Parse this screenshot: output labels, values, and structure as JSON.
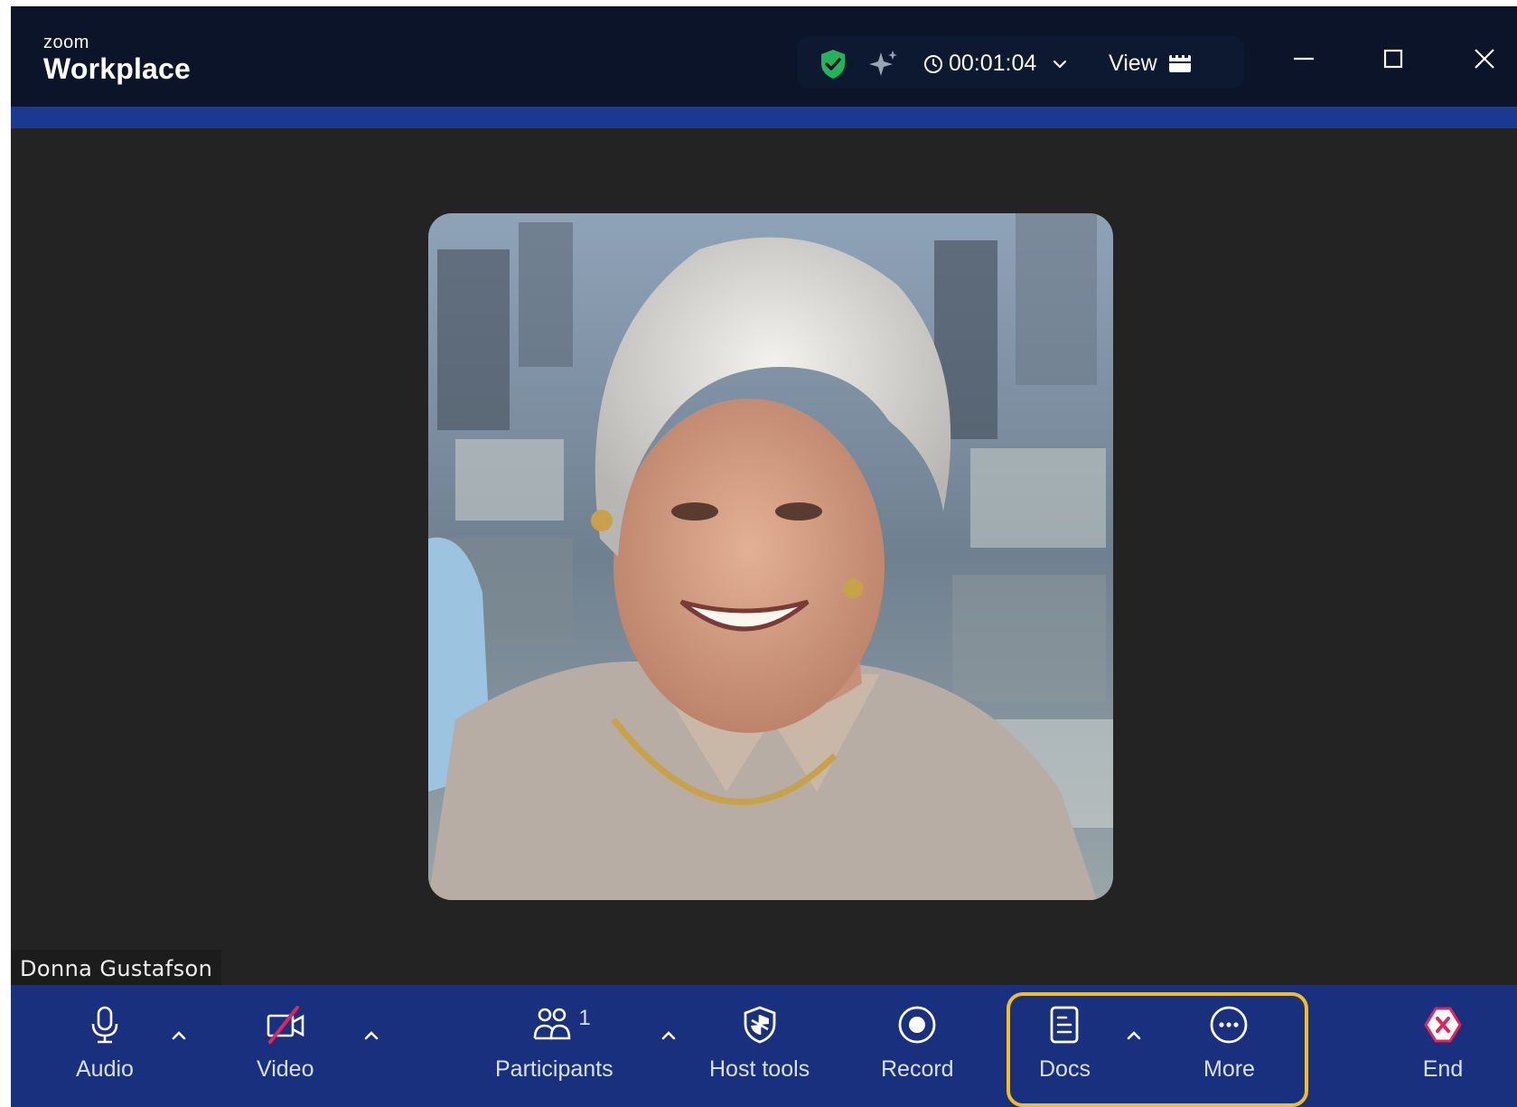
{
  "app": {
    "brand_small": "zoom",
    "brand_large": "Workplace"
  },
  "header": {
    "timer": "00:01:04",
    "view_label": "View",
    "icons": [
      "shield-check-icon",
      "ai-sparkle-icon",
      "clock-icon",
      "chevron-down-icon",
      "view-grid-icon"
    ],
    "security_color": "#23b35a"
  },
  "window_controls": {
    "icons": [
      "minimize-icon",
      "maximize-icon",
      "close-icon"
    ]
  },
  "video": {
    "participant_name": "Donna Gustafson"
  },
  "toolbar": {
    "audio_label": "Audio",
    "video_label": "Video",
    "participants_label": "Participants",
    "participants_count": "1",
    "host_tools_label": "Host tools",
    "record_label": "Record",
    "docs_label": "Docs",
    "more_label": "More",
    "end_label": "End",
    "end_color": "#e0245e",
    "highlight_color": "#f5bd1e"
  }
}
